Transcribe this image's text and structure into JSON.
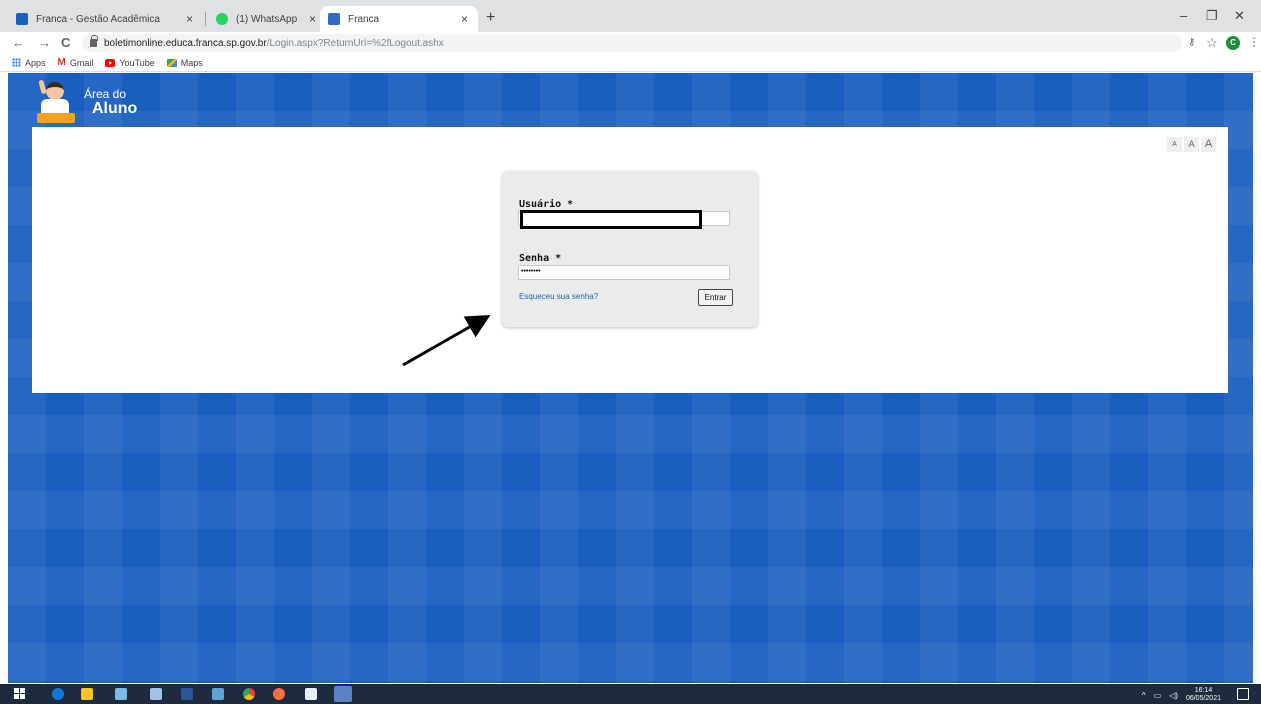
{
  "browser": {
    "tabs": [
      {
        "title": "Franca - Gestão Acadêmica",
        "favicon_color": "#1a5fc0",
        "active": false
      },
      {
        "title": "(1) WhatsApp",
        "favicon_color": "#25d366",
        "active": false
      },
      {
        "title": "Franca",
        "favicon_color": "#2f6ac9",
        "active": true
      }
    ],
    "tab_close_glyph": "×",
    "new_tab_glyph": "+",
    "window_controls": {
      "minimize": "–",
      "restore": "❐",
      "close": "✕"
    },
    "nav": {
      "back": "←",
      "forward": "→",
      "reload": "C"
    },
    "url_host": "boletimonline.educa.franca.sp.gov.br",
    "url_path": "/Login.aspx?ReturnUrl=%2fLogout.ashx",
    "profile_initial": "C",
    "bookmarks": [
      {
        "label": "Apps",
        "icon": "apps-icon"
      },
      {
        "label": "Gmail",
        "icon": "gmail-icon"
      },
      {
        "label": "YouTube",
        "icon": "youtube-icon"
      },
      {
        "label": "Maps",
        "icon": "maps-icon"
      }
    ]
  },
  "site": {
    "brand_line1": "Área do",
    "brand_line2": "Aluno",
    "font_size_buttons": [
      "A",
      "A",
      "A"
    ],
    "background_color": "#1a5fc0"
  },
  "login": {
    "user_label": "Usuário *",
    "user_value": "",
    "password_label": "Senha *",
    "password_value": "••••••••",
    "forgot_link": "Esqueceu sua senha?",
    "submit_label": "Entrar"
  },
  "taskbar": {
    "time": "16:14",
    "date": "06/05/2021",
    "tray_caret": "^",
    "apps": [
      "edge-icon",
      "file-explorer-icon",
      "paint-icon",
      "paint3d-icon",
      "word-icon",
      "notepad-icon",
      "chrome-icon",
      "firefox-icon",
      "mail-icon",
      "teams-icon"
    ]
  }
}
